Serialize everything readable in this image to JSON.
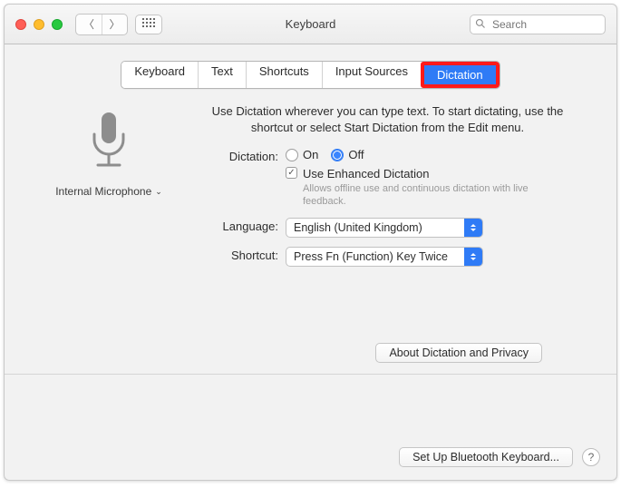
{
  "window": {
    "title": "Keyboard"
  },
  "search": {
    "placeholder": "Search"
  },
  "tabs": {
    "items": [
      {
        "label": "Keyboard"
      },
      {
        "label": "Text"
      },
      {
        "label": "Shortcuts"
      },
      {
        "label": "Input Sources"
      },
      {
        "label": "Dictation"
      }
    ],
    "active_index": 4
  },
  "mic": {
    "label": "Internal Microphone"
  },
  "intro": "Use Dictation wherever you can type text. To start dictating, use the shortcut or select Start Dictation from the Edit menu.",
  "dictation": {
    "label": "Dictation:",
    "on": "On",
    "off": "Off",
    "selected": "off",
    "enhanced_label": "Use Enhanced Dictation",
    "enhanced_checked": true,
    "enhanced_hint": "Allows offline use and continuous dictation with live feedback."
  },
  "language": {
    "label": "Language:",
    "value": "English (United Kingdom)"
  },
  "shortcut": {
    "label": "Shortcut:",
    "value": "Press Fn (Function) Key Twice"
  },
  "about_button": "About Dictation and Privacy",
  "bluetooth_button": "Set Up Bluetooth Keyboard...",
  "help": "?"
}
